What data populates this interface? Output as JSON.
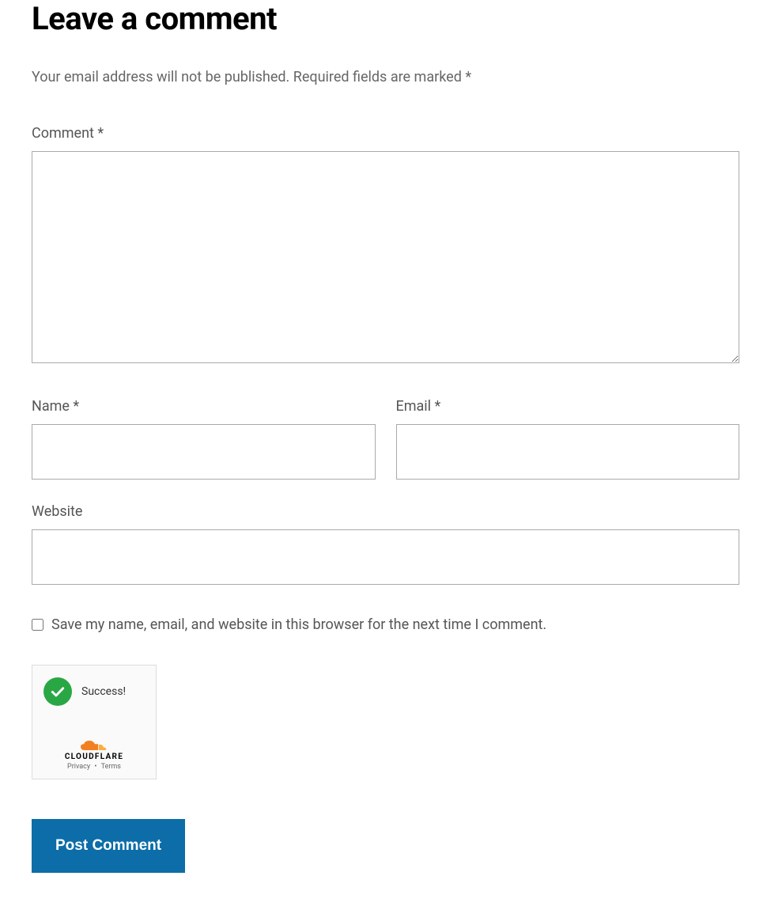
{
  "heading": "Leave a comment",
  "notice": "Your email address will not be published. Required fields are marked *",
  "fields": {
    "comment": {
      "label": "Comment *",
      "value": ""
    },
    "name": {
      "label": "Name *",
      "value": ""
    },
    "email": {
      "label": "Email *",
      "value": ""
    },
    "website": {
      "label": "Website",
      "value": ""
    }
  },
  "saveInfo": {
    "label": "Save my name, email, and website in this browser for the next time I comment.",
    "checked": false
  },
  "turnstile": {
    "status": "Success!",
    "brand": "CLOUDFLARE",
    "privacy": "Privacy",
    "terms": "Terms"
  },
  "submit": {
    "label": "Post Comment"
  },
  "colors": {
    "submitBg": "#0c6da8",
    "successGreen": "#2aa745",
    "cloudOrange": "#f38020"
  }
}
